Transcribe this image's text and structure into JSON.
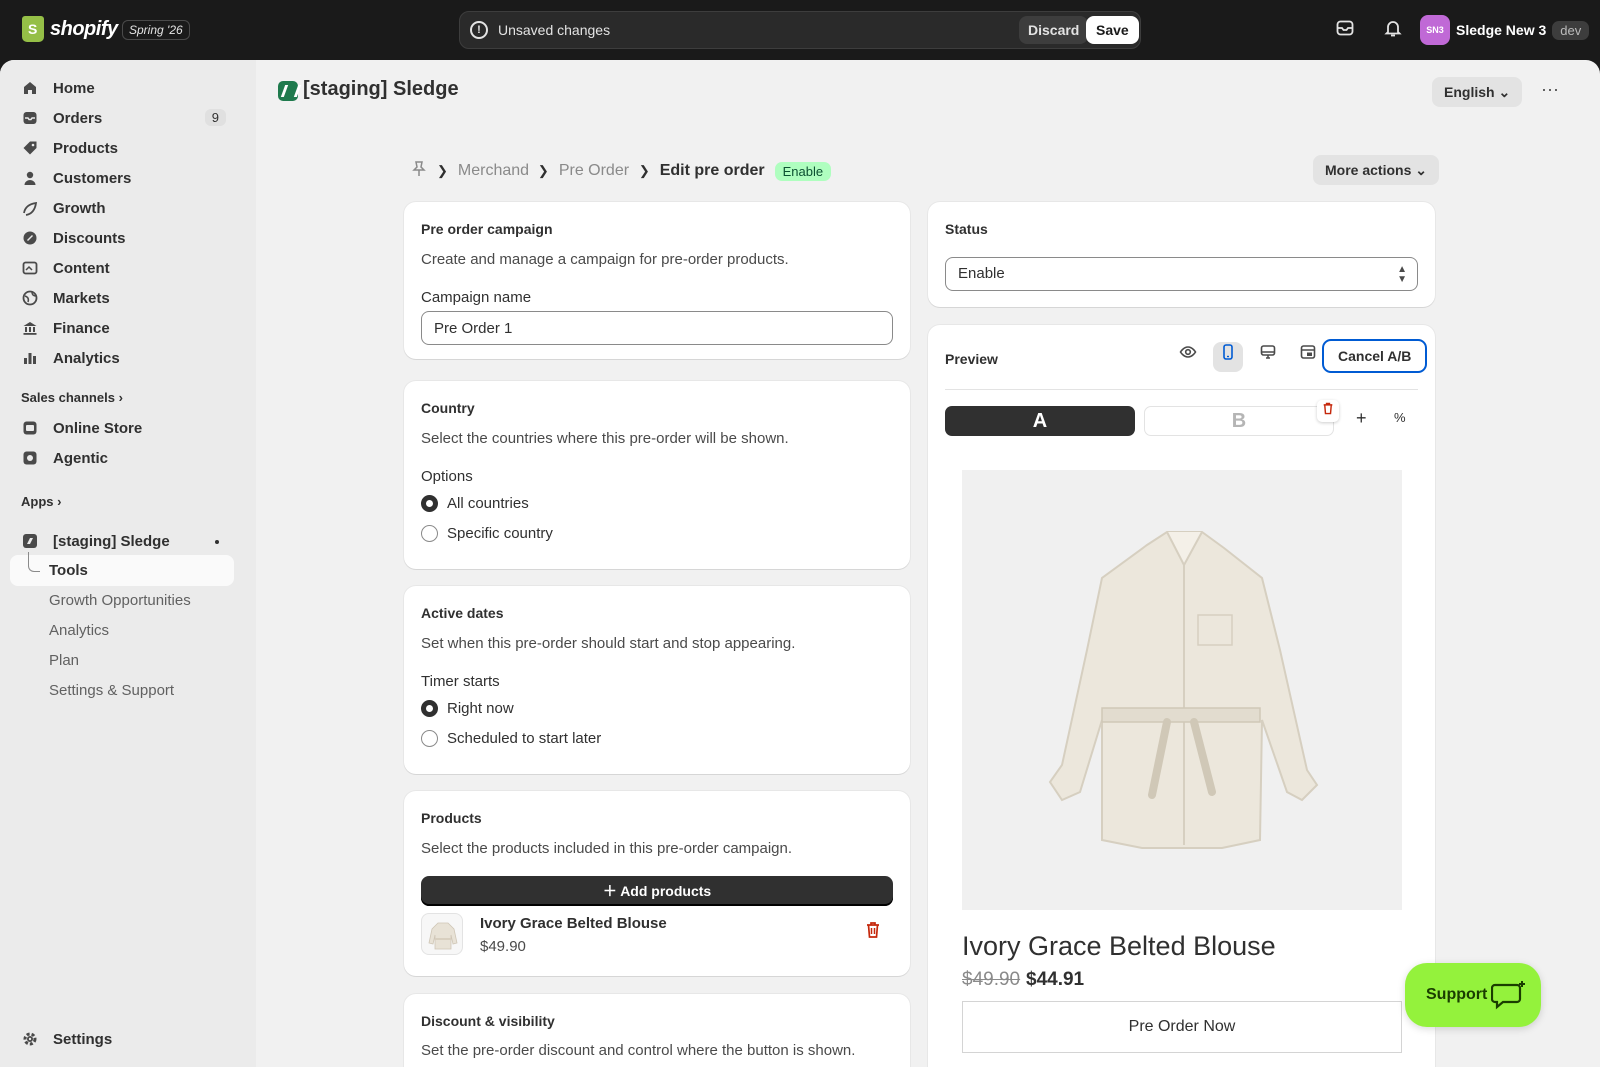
{
  "topbar": {
    "brand": "shopify",
    "edition": "Spring '26",
    "unsaved_text": "Unsaved changes",
    "discard_label": "Discard",
    "save_label": "Save",
    "store_initials": "SN3",
    "store_name": "Sledge New 3",
    "env_badge": "dev"
  },
  "sidebar": {
    "items": [
      {
        "label": "Home",
        "icon": "home-icon"
      },
      {
        "label": "Orders",
        "icon": "inbox-icon",
        "count": "9"
      },
      {
        "label": "Products",
        "icon": "tag-icon"
      },
      {
        "label": "Customers",
        "icon": "person-icon"
      },
      {
        "label": "Growth",
        "icon": "growth-icon"
      },
      {
        "label": "Discounts",
        "icon": "discount-icon"
      },
      {
        "label": "Content",
        "icon": "content-icon"
      },
      {
        "label": "Markets",
        "icon": "globe-icon"
      },
      {
        "label": "Finance",
        "icon": "bank-icon"
      },
      {
        "label": "Analytics",
        "icon": "bar-chart-icon"
      }
    ],
    "sales_channels_label": "Sales channels",
    "channels": [
      {
        "label": "Online Store",
        "icon": "store-icon"
      },
      {
        "label": "Agentic",
        "icon": "agentic-icon"
      }
    ],
    "apps_label": "Apps",
    "app_name": "[staging] Sledge",
    "app_subitems": [
      "Tools",
      "Growth Opportunities",
      "Analytics",
      "Plan",
      "Settings & Support"
    ],
    "settings_label": "Settings"
  },
  "header": {
    "app_title": "[staging] Sledge",
    "language": "English"
  },
  "breadcrumb": {
    "items": [
      "Merchandising",
      "Pre Order"
    ],
    "current": "Edit pre order",
    "badge": "Enable",
    "more_actions": "More actions"
  },
  "campaign": {
    "title": "Pre order campaign",
    "description": "Create and manage a campaign for pre-order products.",
    "name_label": "Campaign name",
    "name_value": "Pre Order 1"
  },
  "country": {
    "title": "Country",
    "description": "Select the countries where this pre-order will be shown.",
    "options_label": "Options",
    "options": [
      "All countries",
      "Specific country"
    ],
    "selected": "All countries"
  },
  "dates": {
    "title": "Active dates",
    "description": "Set when this pre-order should start and stop appearing.",
    "timer_label": "Timer starts",
    "options": [
      "Right now",
      "Scheduled to start later"
    ],
    "selected": "Right now"
  },
  "products": {
    "title": "Products",
    "description": "Select the products included in this pre-order campaign.",
    "add_label": "Add products",
    "items": [
      {
        "name": "Ivory Grace Belted Blouse",
        "price": "$49.90"
      }
    ]
  },
  "discount": {
    "title": "Discount & visibility",
    "description": "Set the pre-order discount and control where the button is shown."
  },
  "status": {
    "title": "Status",
    "value": "Enable"
  },
  "preview": {
    "title": "Preview",
    "cancel_ab": "Cancel A/B",
    "variant_a": "A",
    "variant_b": "B",
    "product_title": "Ivory Grace Belted Blouse",
    "old_price": "$49.90",
    "new_price": "$44.91",
    "button_label": "Pre Order Now"
  },
  "support": {
    "label": "Support"
  },
  "colors": {
    "accent": "#005bd3",
    "support_bg": "#94f23c",
    "badge_bg": "#affebf",
    "danger": "#c5280c"
  }
}
